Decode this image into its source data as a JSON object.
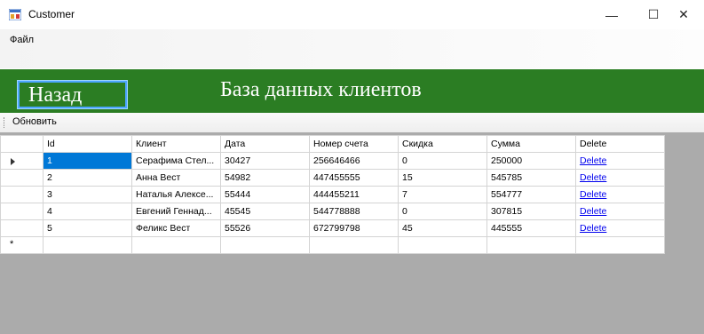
{
  "window": {
    "title": "Customer",
    "min_glyph": "—",
    "max_glyph": "☐",
    "close_glyph": "✕"
  },
  "menu": {
    "file_label": "Файл"
  },
  "header": {
    "back_label": "Назад",
    "title": "База данных клиентов",
    "color": "#2b7d23"
  },
  "toolbar": {
    "refresh_label": "Обновить"
  },
  "grid": {
    "columns": [
      "Id",
      "Клиент",
      "Дата",
      "Номер счета",
      "Скидка",
      "Сумма",
      "Delete"
    ],
    "rows": [
      {
        "id": "1",
        "client": "Серафима Стел...",
        "date": "30427",
        "account": "256646466",
        "discount": "0",
        "sum": "250000",
        "delete": "Delete"
      },
      {
        "id": "2",
        "client": "Анна Вест",
        "date": "54982",
        "account": "447455555",
        "discount": "15",
        "sum": "545785",
        "delete": "Delete"
      },
      {
        "id": "3",
        "client": "Наталья Алексе...",
        "date": "55444",
        "account": "444455211",
        "discount": "7",
        "sum": "554777",
        "delete": "Delete"
      },
      {
        "id": "4",
        "client": "Евгений Геннад...",
        "date": "45545",
        "account": "544778888",
        "discount": "0",
        "sum": "307815",
        "delete": "Delete"
      },
      {
        "id": "5",
        "client": "Феликс Вест",
        "date": "55526",
        "account": "672799798",
        "discount": "45",
        "sum": "445555",
        "delete": "Delete"
      }
    ],
    "new_row_marker": "*",
    "selection_color": "#0078d7"
  }
}
